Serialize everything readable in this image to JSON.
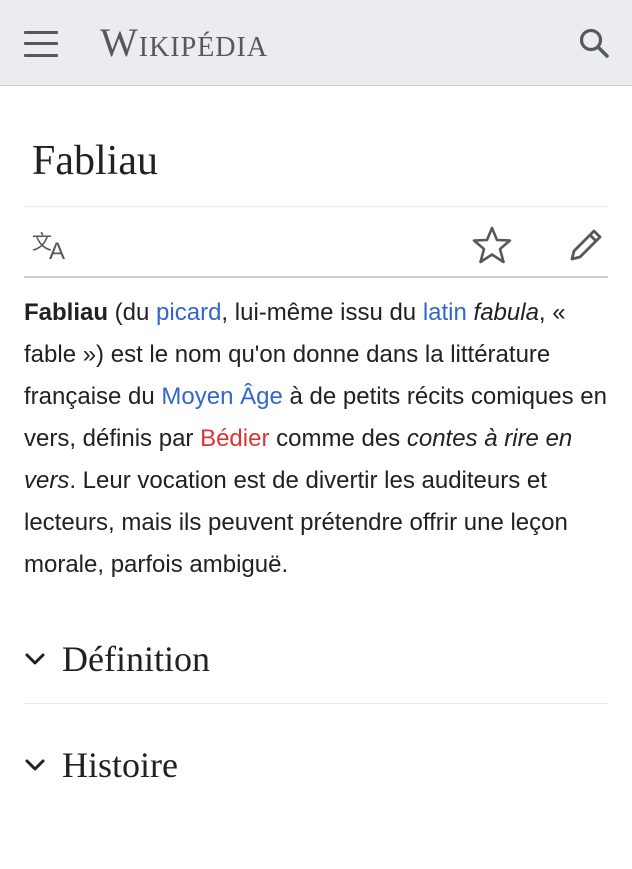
{
  "header": {
    "wordmark": "Wikipédia",
    "menu_icon": "hamburger-menu-icon",
    "search_icon": "search-icon"
  },
  "page": {
    "title": "Fabliau"
  },
  "toolbar": {
    "language_icon": "language-icon",
    "watch_icon": "star-icon",
    "edit_icon": "pencil-icon"
  },
  "intro": {
    "term": "Fabliau",
    "t1": " (du ",
    "link_picard": "picard",
    "t2": ", lui-même issu du ",
    "link_latin": "latin",
    "t3": " ",
    "latin_word": "fabula",
    "t4": ", « fable ») est le nom qu'on donne dans la littérature française du ",
    "link_moyen_age": "Moyen Âge",
    "t5": " à de petits récits comiques en vers, définis par ",
    "link_bedier": "Bédier",
    "t6": " comme des ",
    "bedier_quote": "contes à rire en vers",
    "t7": ". Leur vocation est de divertir les auditeurs et lecteurs, mais ils peuvent prétendre offrir une leçon morale, parfois ambiguë."
  },
  "sections": [
    {
      "title": "Définition"
    },
    {
      "title": "Histoire"
    }
  ],
  "colors": {
    "link": "#3366cc",
    "redlink": "#dd3333",
    "header_bg": "#eaecf0",
    "text": "#202122",
    "icon": "#54595d"
  }
}
